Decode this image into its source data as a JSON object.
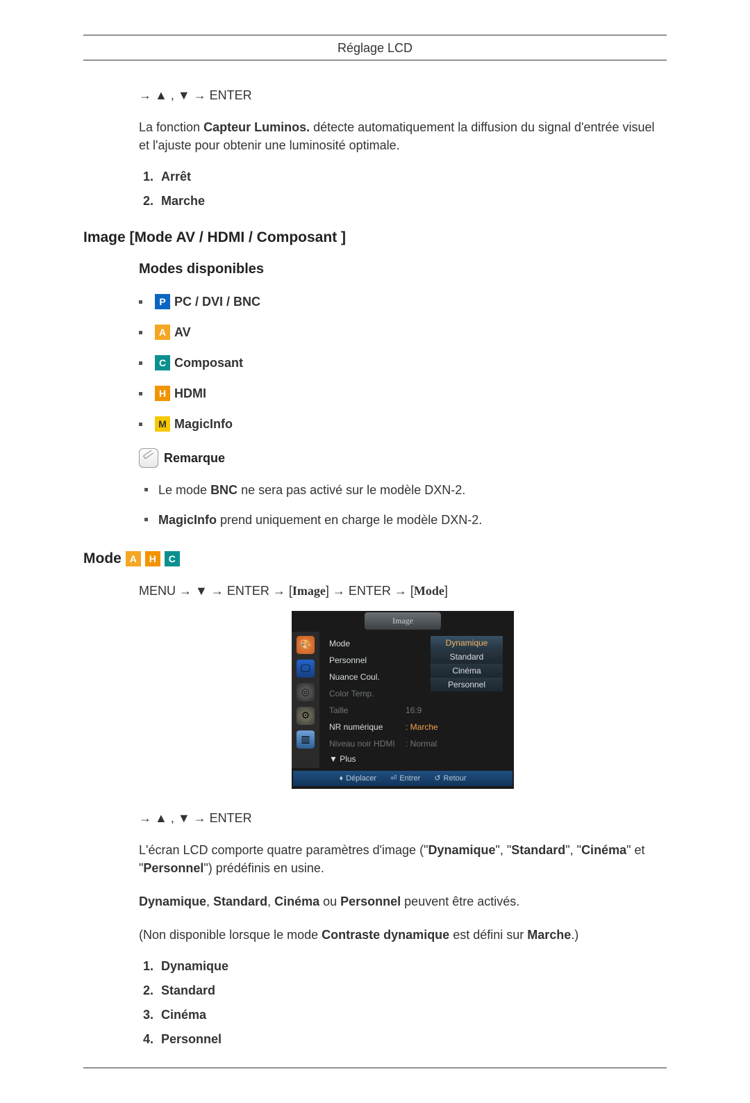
{
  "header": {
    "title": "Réglage LCD"
  },
  "section1": {
    "nav": "→ ▲ , ▼ → ENTER",
    "para_pre": "La fonction ",
    "para_bold": "Capteur Luminos.",
    "para_post": "   détecte automatiquement la diffusion du signal d'entrée visuel et l'ajuste pour obtenir une luminosité optimale.",
    "options": [
      "Arrêt",
      "Marche"
    ]
  },
  "section2": {
    "title": "Image [Mode AV / HDMI / Composant ]",
    "subtitle": "Modes disponibles",
    "modes": [
      {
        "icon": "P",
        "cls": "icon-p",
        "label": "PC / DVI / BNC"
      },
      {
        "icon": "A",
        "cls": "icon-a",
        "label": "AV"
      },
      {
        "icon": "C",
        "cls": "icon-c",
        "label": "Composant"
      },
      {
        "icon": "H",
        "cls": "icon-h",
        "label": "HDMI"
      },
      {
        "icon": "M",
        "cls": "icon-m",
        "label": "MagicInfo"
      }
    ],
    "note_label": "Remarque",
    "notes": [
      {
        "pre": "Le mode ",
        "b": "BNC",
        "post": " ne sera pas activé sur le modèle DXN-2."
      },
      {
        "pre": "",
        "b": "MagicInfo",
        "post": " prend uniquement en charge le modèle DXN-2."
      }
    ]
  },
  "section3": {
    "title": "Mode",
    "title_icons": [
      {
        "icon": "A",
        "cls": "icon-a"
      },
      {
        "icon": "H",
        "cls": "icon-h"
      },
      {
        "icon": "C",
        "cls": "icon-c"
      }
    ],
    "menu_path": {
      "p1": "MENU → ▼ → ENTER → [",
      "s1": "Image",
      "p2": "] → ENTER → [",
      "s2": "Mode",
      "p3": "]"
    },
    "osd": {
      "title": "Image",
      "rows": [
        {
          "label": "Mode",
          "value": "",
          "lcls": "c-white",
          "vcls": ""
        },
        {
          "label": "Personnel",
          "value": "",
          "lcls": "c-white",
          "vcls": ""
        },
        {
          "label": "Nuance Coul.",
          "value": "",
          "lcls": "c-white",
          "vcls": ""
        },
        {
          "label": "Color Temp.",
          "value": "",
          "lcls": "c-dim",
          "vcls": ""
        },
        {
          "label": "Taille",
          "value": "16:9",
          "lcls": "c-dim",
          "vcls": "c-dim"
        },
        {
          "label": "NR numérique",
          "value": ": Marche",
          "lcls": "c-white",
          "vcls": "c-orange"
        },
        {
          "label": "Niveau noir HDMI",
          "value": ": Normal",
          "lcls": "c-dim",
          "vcls": "c-dim"
        }
      ],
      "plus": "▼  Plus",
      "sel": [
        {
          "label": "Dynamique",
          "active": true
        },
        {
          "label": "Standard",
          "active": false
        },
        {
          "label": "Cinéma",
          "active": false
        },
        {
          "label": "Personnel",
          "active": false
        }
      ],
      "footer": {
        "move": "Déplacer",
        "enter": "Entrer",
        "return": "Retour"
      }
    },
    "nav2": "→ ▲ , ▼ → ENTER",
    "p1": {
      "pre": "L'écran LCD comporte quatre paramètres d'image (\"",
      "b1": "Dynamique",
      "m1": "\", \"",
      "b2": "Standard",
      "m2": "\", \"",
      "b3": "Cinéma",
      "m3": "\" et \"",
      "b4": "Personnel",
      "post": "\") prédéfinis en usine."
    },
    "p2": {
      "b1": "Dynamique",
      "s1": ", ",
      "b2": "Standard",
      "s2": ", ",
      "b3": "Cinéma",
      "s3": " ou ",
      "b4": "Personnel",
      "post": " peuvent être activés."
    },
    "p3": {
      "pre": "(Non disponible lorsque le mode ",
      "b1": "Contraste dynamique",
      "mid": " est défini sur ",
      "b2": "Marche",
      "post": ".)"
    },
    "options": [
      "Dynamique",
      "Standard",
      "Cinéma",
      "Personnel"
    ]
  }
}
